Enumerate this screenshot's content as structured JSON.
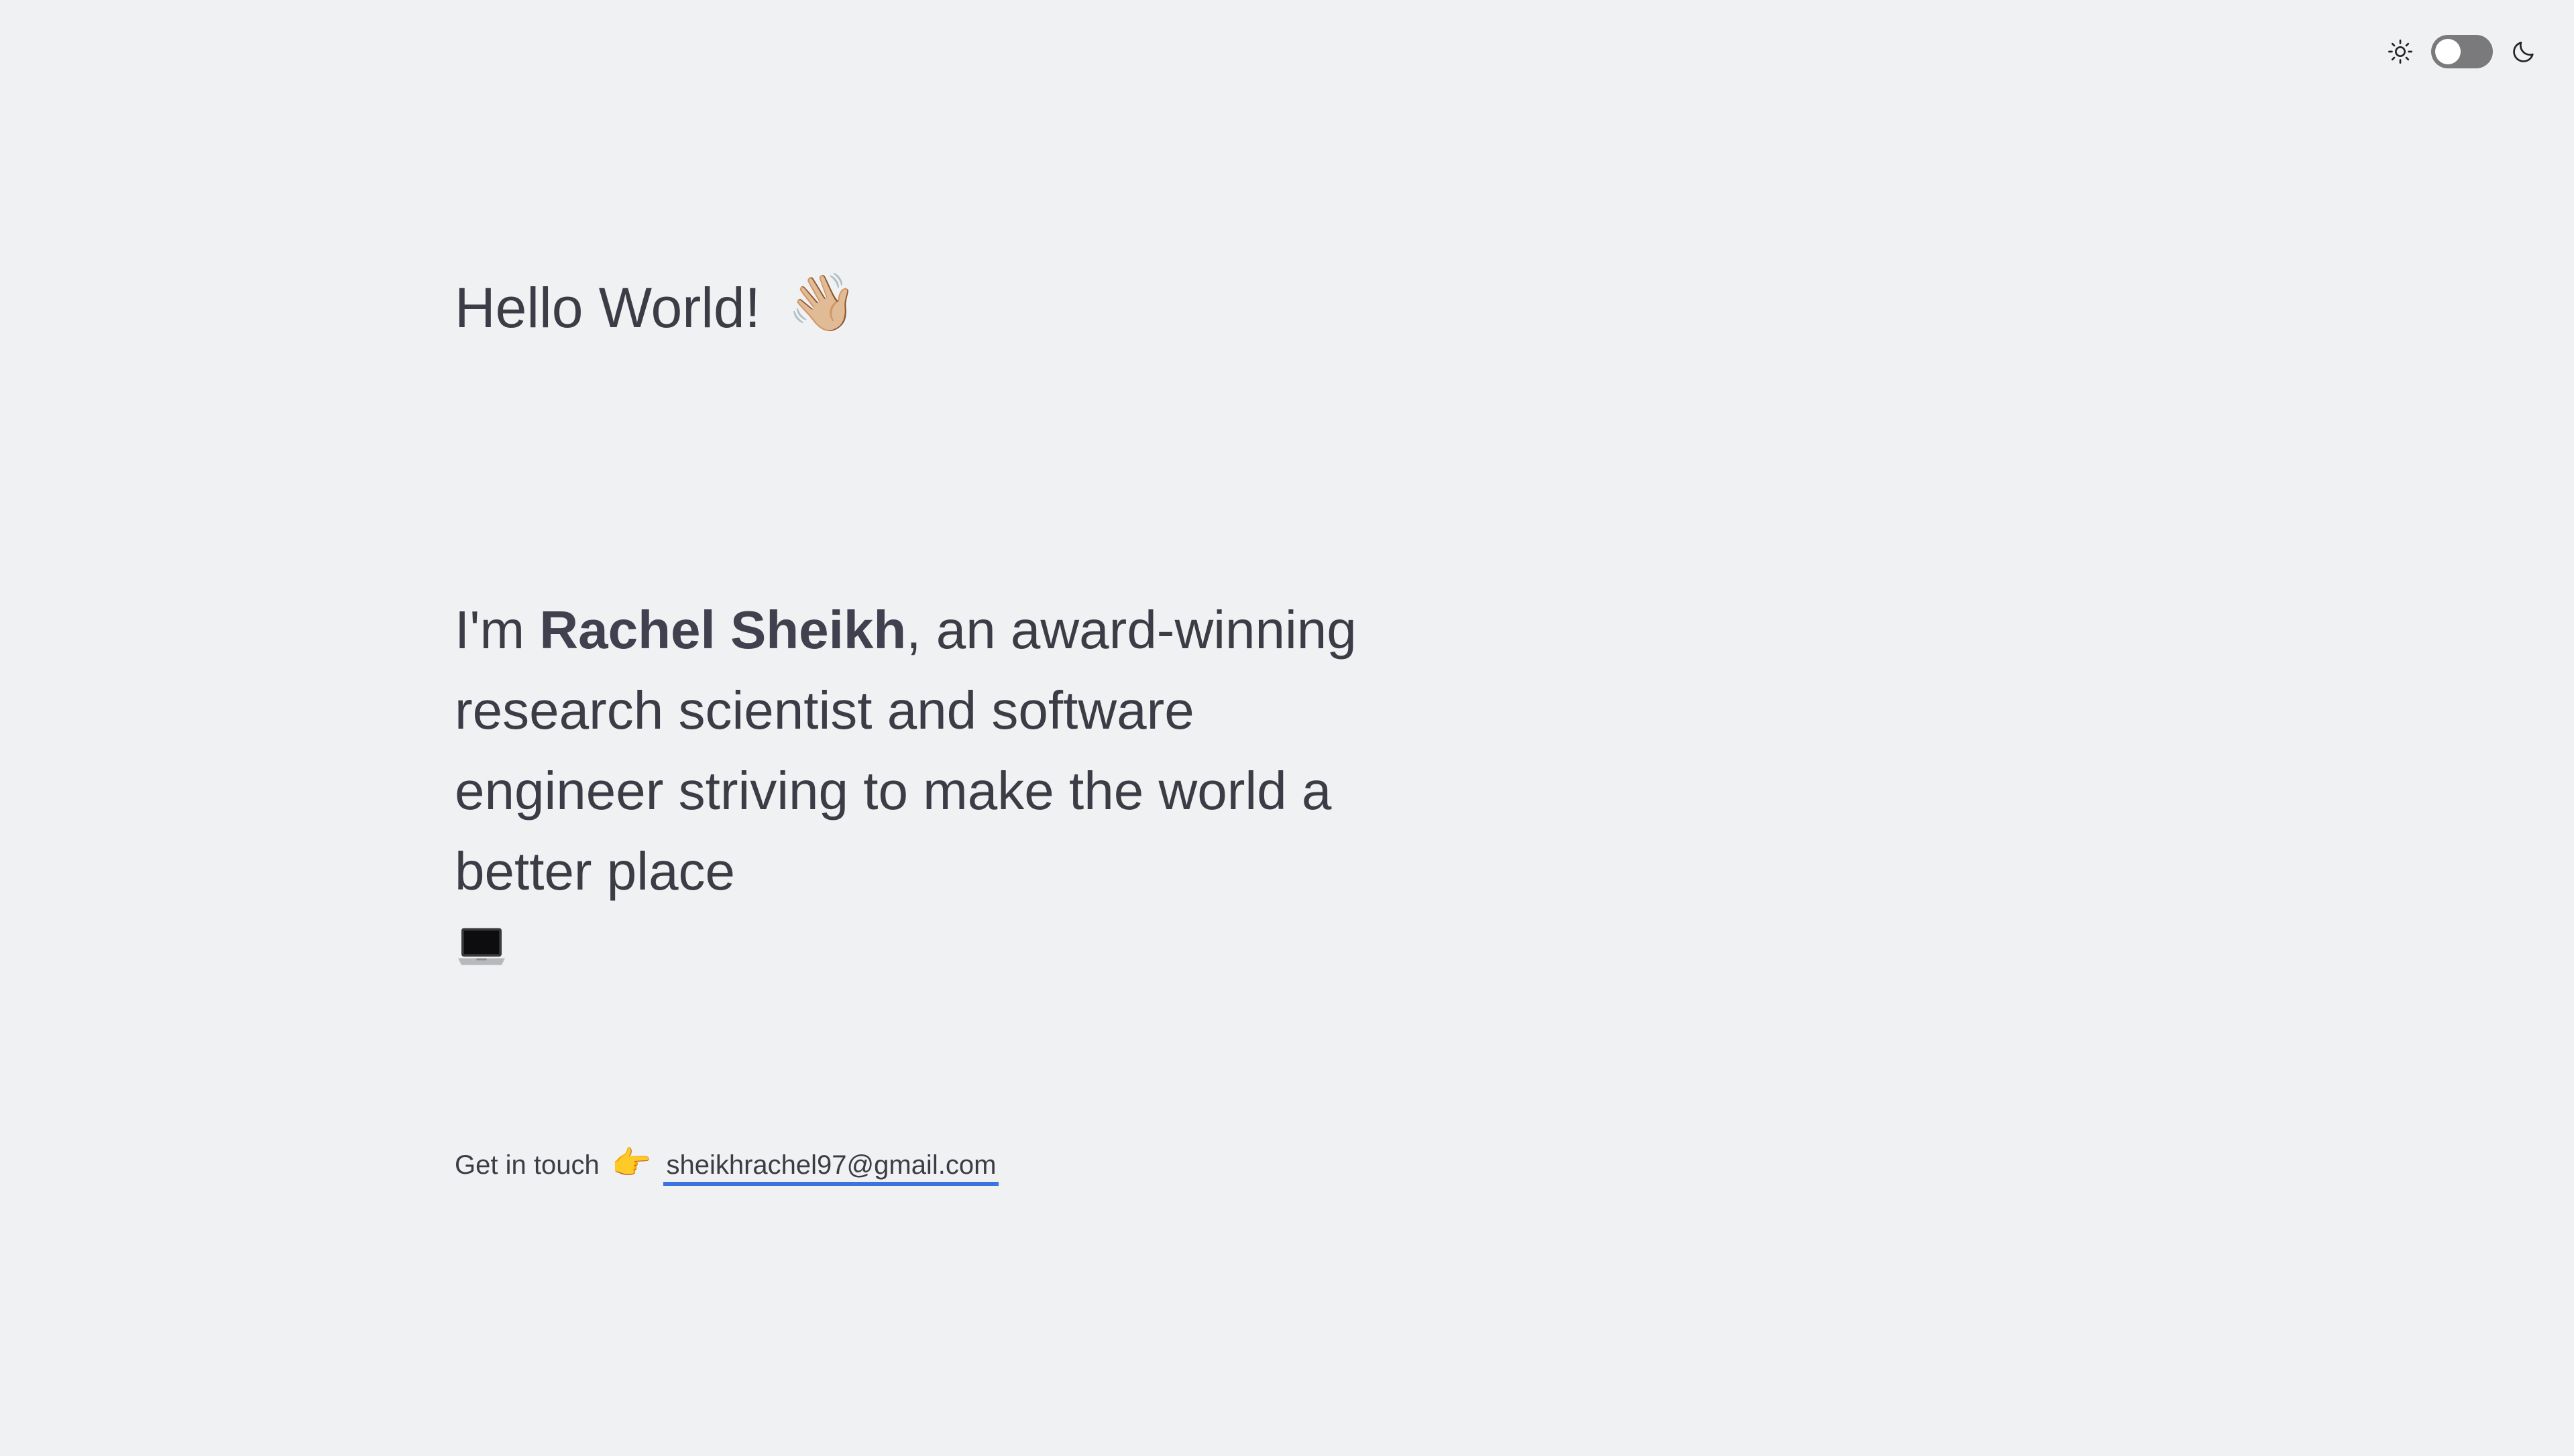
{
  "theme_toggle": {
    "sun_icon": "sun-icon",
    "moon_icon": "moon-icon",
    "state": "light"
  },
  "greeting": {
    "text": "Hello World!",
    "emoji": "👋🏼"
  },
  "intro": {
    "prefix": "I'm ",
    "name": "Rachel Sheikh",
    "suffix": ", an award-winning research scientist and software engineer striving to make the world a better place",
    "icon": "laptop-icon"
  },
  "contact": {
    "label": "Get in touch",
    "emoji": "👉",
    "email": "sheikhrachel97@gmail.com"
  },
  "colors": {
    "background": "#f0f1f3",
    "text": "#3c3c46",
    "link_underline": "#3b74e0",
    "toggle_track": "#7a7a7d"
  }
}
